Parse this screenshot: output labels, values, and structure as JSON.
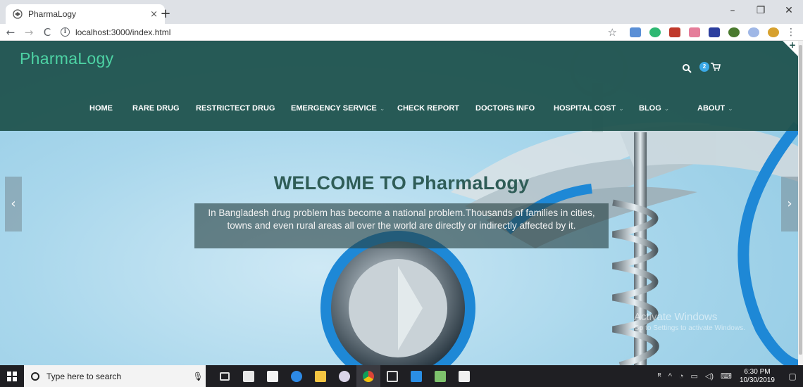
{
  "browser": {
    "tab_title": "PharmaLogy",
    "tab_close": "×",
    "new_tab": "+",
    "url": "localhost:3000/index.html",
    "window_controls": [
      "–",
      "❐",
      "✕"
    ]
  },
  "site": {
    "logo": "PharmaLogy",
    "cart_count": "2",
    "menu": [
      {
        "label": "HOME",
        "dropdown": false
      },
      {
        "label": "RARE DRUG",
        "dropdown": false
      },
      {
        "label": "RESTRICTECT DRUG",
        "dropdown": false
      },
      {
        "label": "EMERGENCY SERVICE",
        "dropdown": true
      },
      {
        "label": "CHECK REPORT",
        "dropdown": false
      },
      {
        "label": "DOCTORS INFO",
        "dropdown": false
      },
      {
        "label": "HOSPITAL COST",
        "dropdown": true
      },
      {
        "label": "BLOG",
        "dropdown": true
      },
      {
        "label": "ABOUT",
        "dropdown": true
      }
    ],
    "menu_caret": "⌄"
  },
  "hero": {
    "title": "WELCOME TO PharmaLogy",
    "caption": "In Bangladesh drug problem has become a national problem.Thousands of families in cities, towns and even rural areas all over the world are directly or indirectly affected by it.",
    "prev_arrow": "‹",
    "next_arrow": "›"
  },
  "watermark": {
    "line1": "Activate Windows",
    "line2": "Go to Settings to activate Windows."
  },
  "taskbar": {
    "search_placeholder": "Type here to search",
    "time": "6:30 PM",
    "date": "10/30/2019",
    "apps": [
      "task-view",
      "mail",
      "store",
      "edge",
      "file-explorer",
      "paint",
      "chrome",
      "terminal",
      "vscode",
      "notepad",
      "photos"
    ]
  },
  "colors": {
    "header_bg": "#1f524c",
    "logo": "#4dd3a4",
    "badge": "#3ba9e6"
  }
}
